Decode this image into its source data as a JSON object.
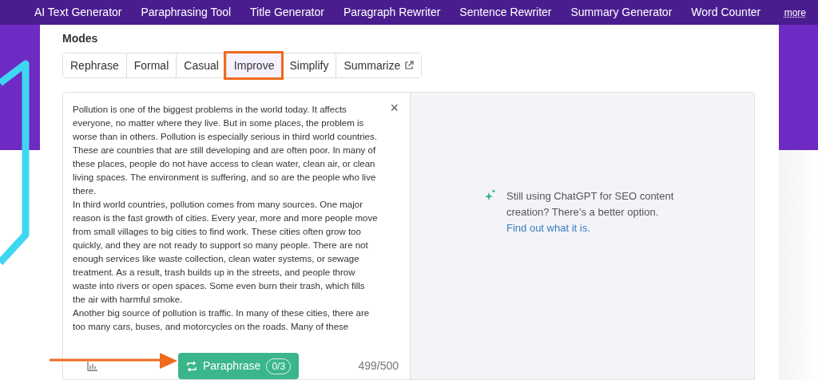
{
  "nav": {
    "items": [
      "AI Text Generator",
      "Paraphrasing Tool",
      "Title Generator",
      "Paragraph Rewriter",
      "Sentence Rewriter",
      "Summary Generator",
      "Word Counter"
    ],
    "more": "more"
  },
  "modes": {
    "label": "Modes",
    "items": [
      {
        "label": "Rephrase",
        "selected": false,
        "external": false
      },
      {
        "label": "Formal",
        "selected": false,
        "external": false
      },
      {
        "label": "Casual",
        "selected": false,
        "external": false
      },
      {
        "label": "Improve",
        "selected": true,
        "external": false
      },
      {
        "label": "Simplify",
        "selected": false,
        "external": false
      },
      {
        "label": "Summarize",
        "selected": false,
        "external": true
      }
    ]
  },
  "editor": {
    "lines": [
      "Pollution is one of the biggest problems in the world today. It affects",
      "everyone, no matter where they live. But in some places, the problem is",
      "worse than in others. Pollution is especially serious in third world countries.",
      "These are countries that are still developing and are often poor. In many of",
      "these places, people do not have access to clean water, clean air, or clean",
      "living spaces. The environment is suffering, and so are the people who live",
      "there.",
      "In third world countries, pollution comes from many sources. One major",
      "reason is the fast growth of cities. Every year, more and more people move",
      "from small villages to big cities to find work. These cities often grow too",
      "quickly, and they are not ready to support so many people. There are not",
      "enough services like waste collection, clean water systems, or sewage",
      "treatment. As a result, trash builds up in the streets, and people throw",
      "waste into rivers or open spaces. Some even burn their trash, which fills",
      "the air with harmful smoke.",
      "Another big source of pollution is traffic. In many of these cities, there are",
      "too many cars, buses, and motorcycles on the roads. Many of these"
    ],
    "close": "×",
    "button": "Paraphrase",
    "uses": "0/3",
    "count": "499/500"
  },
  "promo": {
    "text": "Still using ChatGPT for SEO content creation? There’s a better option.",
    "link": "Find out what it is."
  }
}
